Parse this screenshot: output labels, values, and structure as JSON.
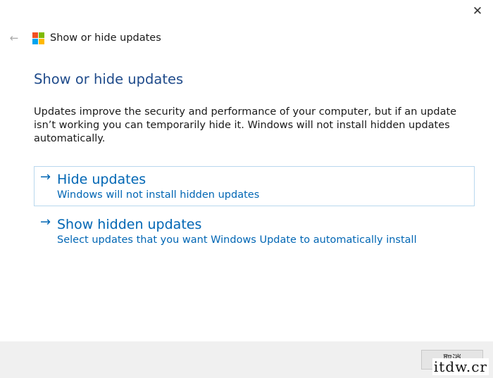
{
  "window": {
    "close_glyph": "✕"
  },
  "titlebar": {
    "back_glyph": "←",
    "title": "Show or hide updates",
    "logo_colors": [
      "#f25022",
      "#7fba00",
      "#00a4ef",
      "#ffb900"
    ]
  },
  "main": {
    "heading": "Show or hide updates",
    "description": "Updates improve the security and performance of your computer, but if an update isn’t working you can temporarily hide it. Windows will not install hidden updates automatically.",
    "options": [
      {
        "arrow": "→",
        "title": "Hide updates",
        "subtitle": "Windows will not install hidden updates"
      },
      {
        "arrow": "→",
        "title": "Show hidden updates",
        "subtitle": "Select updates that you want Windows Update to automatically install"
      }
    ]
  },
  "footer": {
    "cancel_label": "取消",
    "watermark": "itdw.cr"
  },
  "colors": {
    "accent": "#0066b4",
    "heading": "#1e4a8a",
    "footer_bg": "#f0f0f0"
  }
}
